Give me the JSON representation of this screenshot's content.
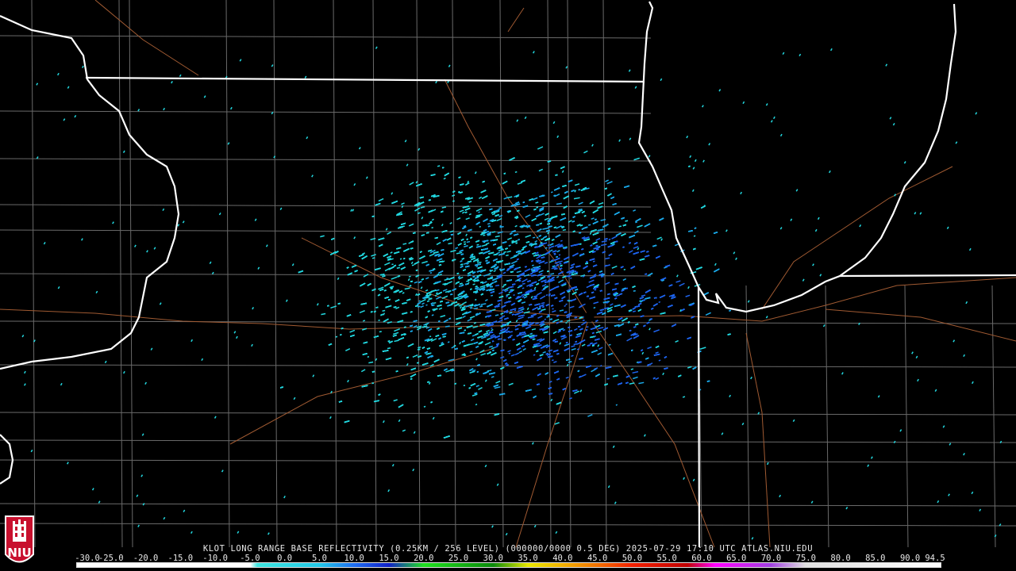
{
  "product": {
    "caption": "KLOT LONG RANGE BASE REFLECTIVITY (0.25KM / 256 LEVEL) (000000/0000 0.5 DEG) 2025-07-29 17:10 UTC  ATLAS.NIU.EDU"
  },
  "colorbar": {
    "labels": [
      "-30.0",
      "-25.0",
      "-20.0",
      "-15.0",
      "-10.0",
      "-5.0",
      "0.0",
      "5.0",
      "10.0",
      "15.0",
      "20.0",
      "25.0",
      "30.0",
      "35.0",
      "40.0",
      "45.0",
      "50.0",
      "55.0",
      "60.0",
      "65.0",
      "70.0",
      "75.0",
      "80.0",
      "85.0",
      "90.0",
      "94.5"
    ],
    "stops": [
      {
        "value": -30,
        "color": "#ffffff"
      },
      {
        "value": -5,
        "color": "#ffffff"
      },
      {
        "value": -4,
        "color": "#3ee6e0"
      },
      {
        "value": 5,
        "color": "#22c8e8"
      },
      {
        "value": 10,
        "color": "#1e6cf0"
      },
      {
        "value": 15,
        "color": "#1020c8"
      },
      {
        "value": 20,
        "color": "#20e020"
      },
      {
        "value": 30,
        "color": "#0a8a0a"
      },
      {
        "value": 35,
        "color": "#e8e800"
      },
      {
        "value": 40,
        "color": "#f0b000"
      },
      {
        "value": 45,
        "color": "#f07000"
      },
      {
        "value": 50,
        "color": "#f02000"
      },
      {
        "value": 58,
        "color": "#c00000"
      },
      {
        "value": 62,
        "color": "#ff00ff"
      },
      {
        "value": 70,
        "color": "#a040e0"
      },
      {
        "value": 75,
        "color": "#e0e0e0"
      },
      {
        "value": 94.5,
        "color": "#ffffff"
      }
    ]
  },
  "logo": {
    "text": "NIU",
    "bg_color": "#c8102e"
  },
  "colors": {
    "echo_light": "#22d8e0",
    "echo_mid": "#1aa8e8",
    "echo_dark": "#1e64ee",
    "state_border": "#ffffff",
    "county_border": "#6a6a6a",
    "road": "#a05a32"
  },
  "radar_site": {
    "id": "KLOT"
  }
}
